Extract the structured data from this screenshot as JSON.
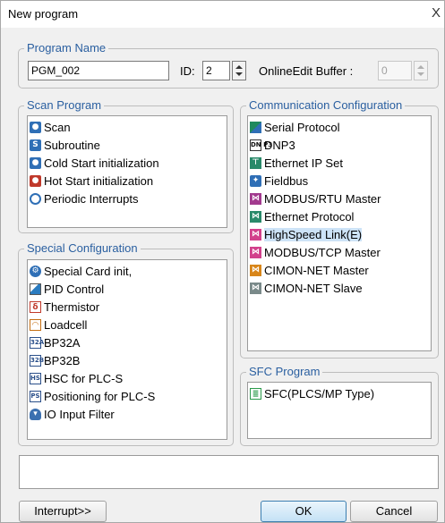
{
  "window": {
    "title": "New program",
    "close_glyph": "X"
  },
  "program_name": {
    "legend": "Program Name",
    "name_value": "PGM_002",
    "id_label": "ID:",
    "id_value": "2",
    "buffer_label": "OnlineEdit Buffer :",
    "buffer_value": "0"
  },
  "scan_program": {
    "legend": "Scan Program",
    "items": [
      {
        "label": "Scan",
        "icon": "scan-icon"
      },
      {
        "label": "Subroutine",
        "icon": "subroutine-icon"
      },
      {
        "label": "Cold Start initialization",
        "icon": "cold-start-icon"
      },
      {
        "label": "Hot Start initialization",
        "icon": "hot-start-icon"
      },
      {
        "label": "Periodic Interrupts",
        "icon": "clock-icon"
      }
    ]
  },
  "special_configuration": {
    "legend": "Special Configuration",
    "items": [
      {
        "label": "Special Card init,",
        "icon": "gear-icon"
      },
      {
        "label": "PID Control",
        "icon": "pid-icon"
      },
      {
        "label": "Thermistor",
        "icon": "thermistor-icon"
      },
      {
        "label": "Loadcell",
        "icon": "loadcell-icon"
      },
      {
        "label": "BP32A",
        "icon": "bp32a-icon",
        "glyph": "32A"
      },
      {
        "label": "BP32B",
        "icon": "bp32b-icon",
        "glyph": "32B"
      },
      {
        "label": "HSC for PLC-S",
        "icon": "hsc-icon",
        "glyph": "HS"
      },
      {
        "label": "Positioning for PLC-S",
        "icon": "positioning-icon",
        "glyph": "PS"
      },
      {
        "label": "IO Input Filter",
        "icon": "filter-icon"
      }
    ]
  },
  "communication_configuration": {
    "legend": "Communication Configuration",
    "items": [
      {
        "label": "Serial Protocol",
        "icon": "serial-protocol-icon"
      },
      {
        "label": "DNP3",
        "icon": "dnp3-icon",
        "glyph": "DN P3"
      },
      {
        "label": "Ethernet IP Set",
        "icon": "ethernet-ip-icon"
      },
      {
        "label": "Fieldbus",
        "icon": "fieldbus-icon"
      },
      {
        "label": "MODBUS/RTU Master",
        "icon": "modbus-rtu-icon"
      },
      {
        "label": "Ethernet Protocol",
        "icon": "ethernet-protocol-icon"
      },
      {
        "label": "HighSpeed Link(E)",
        "icon": "highspeed-link-icon",
        "selected": true
      },
      {
        "label": "MODBUS/TCP Master",
        "icon": "modbus-tcp-icon"
      },
      {
        "label": "CIMON-NET Master",
        "icon": "cimon-master-icon"
      },
      {
        "label": "CIMON-NET Slave",
        "icon": "cimon-slave-icon"
      }
    ]
  },
  "sfc_program": {
    "legend": "SFC Program",
    "items": [
      {
        "label": "SFC(PLCS/MP Type)",
        "icon": "sfc-icon"
      }
    ]
  },
  "buttons": {
    "interrupt": "Interrupt>>",
    "ok": "OK",
    "cancel": "Cancel"
  },
  "colors": {
    "legend_text": "#2a5fa0",
    "selected_bg": "#cde3f7",
    "dialog_bg": "#f0f0f0"
  }
}
